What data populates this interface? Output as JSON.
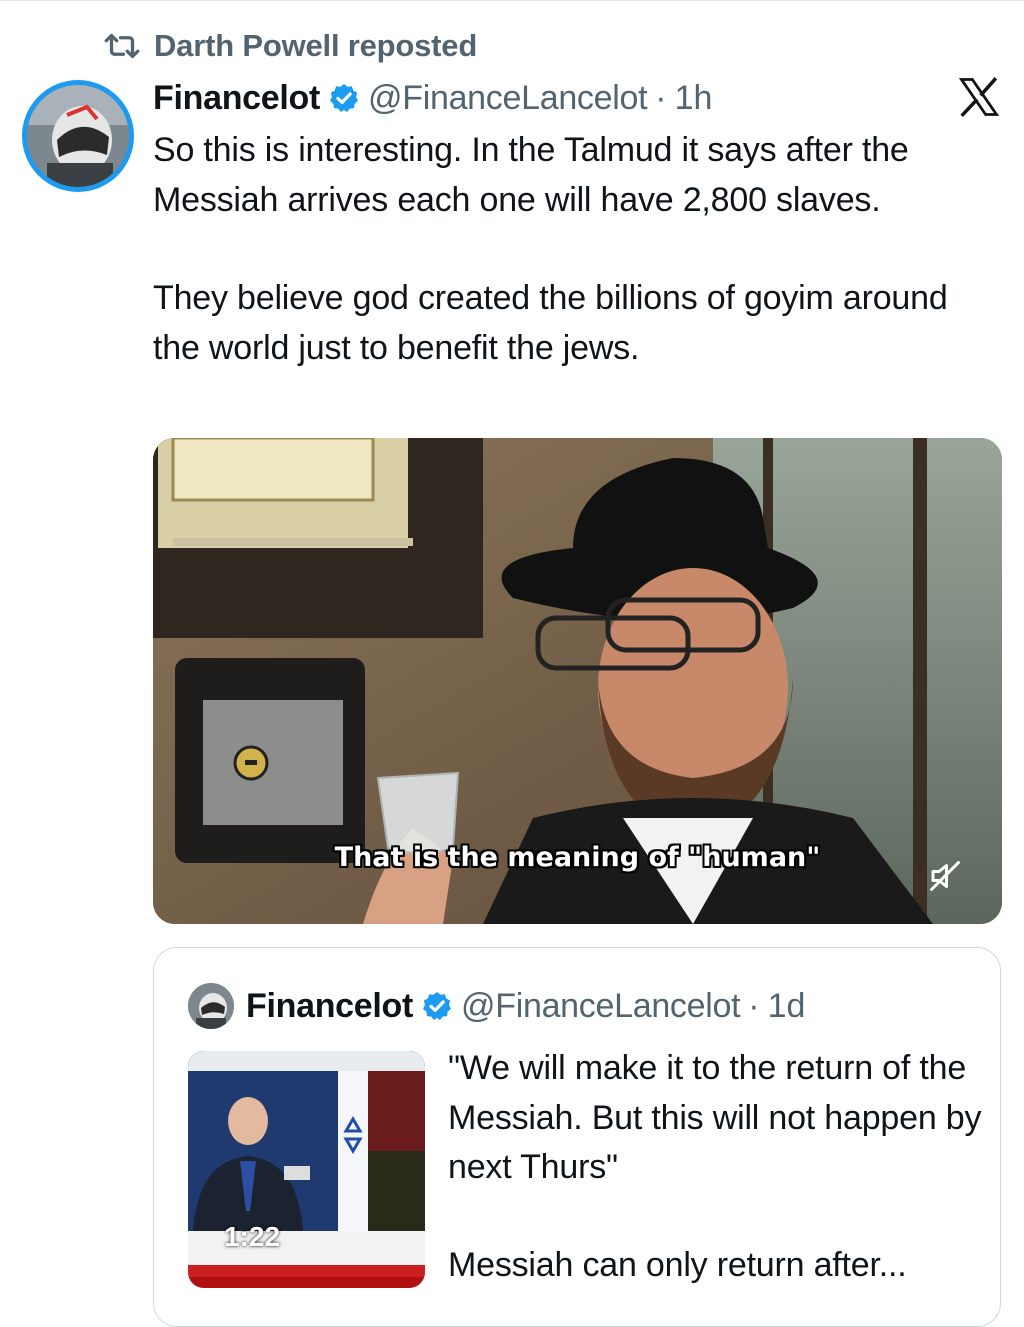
{
  "repost": {
    "icon": "repost-icon",
    "label": "Darth Powell reposted"
  },
  "tweet": {
    "author_name": "Financelot",
    "verified_icon": "verified-badge-icon",
    "handle": "@FinanceLancelot",
    "separator": "·",
    "time": "1h",
    "text_paragraph_1": "So this is interesting. In the Talmud it says after the Messiah arrives each one will have 2,800 slaves.",
    "text_paragraph_2": "They believe god created the billions of goyim around the world just to benefit the jews.",
    "media": {
      "subtitle": "That is the meaning of \"human\"",
      "mute_icon": "muted-speaker-icon"
    }
  },
  "brand_icon": "x-logo-icon",
  "quoted_tweet": {
    "author_name": "Financelot",
    "handle": "@FinanceLancelot",
    "separator": "·",
    "time": "1d",
    "video_duration": "1:22",
    "text_paragraph_1": "\"We will make it to the return of the Messiah. But this will not happen by next Thurs\"",
    "text_paragraph_2": "Messiah can only return after..."
  },
  "colors": {
    "accent": "#1d9bf0",
    "text": "#0f1419",
    "secondary": "#536471",
    "border": "#cfd9de"
  }
}
